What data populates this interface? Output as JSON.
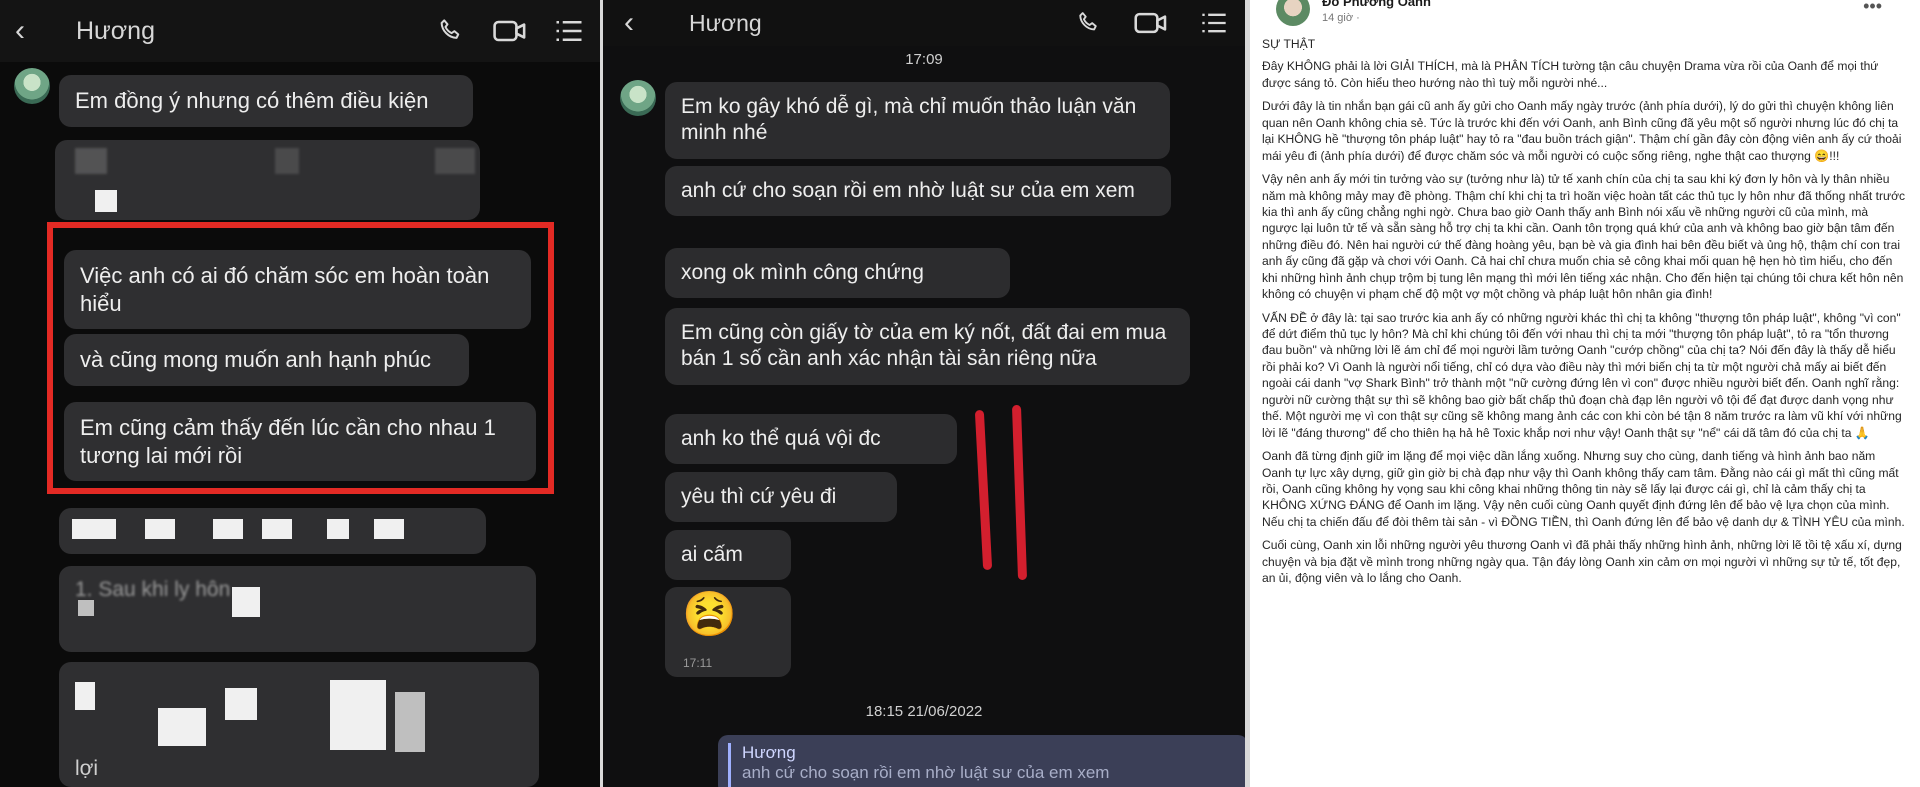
{
  "left_chat": {
    "header": {
      "back_icon": "‹",
      "contact_name": "Hương"
    },
    "messages": [
      "Em đồng ý nhưng có thêm điều kiện",
      "Việc anh có ai đó chăm sóc em hoàn toàn hiểu",
      "và cũng mong muốn anh hạnh phúc",
      "Em cũng cảm thấy đến lúc cần cho nhau 1 tương lai mới rồi"
    ],
    "obscured_fragments": [
      "1. Sau khi ly hôn",
      "lợi"
    ]
  },
  "middle_chat": {
    "header": {
      "back_icon": "‹",
      "contact_name": "Hương"
    },
    "time_top": "17:09",
    "messages": [
      "Em ko gây khó dễ gì, mà chỉ muốn thảo luận văn minh nhé",
      "anh cứ cho soạn rồi em nhờ luật sư của em xem",
      "xong ok mình công chứng",
      "Em cũng còn giấy tờ của em ký nốt, đất đai em mua bán 1 số cần anh xác nhận tài sản riêng nữa",
      "anh ko thể quá vội đc",
      "yêu thì cứ yêu đi",
      "ai cấm"
    ],
    "emoji_time": "17:11",
    "date_separator": "18:15 21/06/2022",
    "reply": {
      "name": "Hương",
      "text": "anh cứ cho soạn rồi em nhờ luật sư của em xem"
    },
    "annotation_color": "#d31f2e"
  },
  "post": {
    "author": "Đỗ Phương Oanh",
    "time": "14 giờ ·",
    "title": "SỰ THẬT",
    "paragraphs": [
      "Đây KHÔNG phải là lời GIẢI THÍCH, mà là PHÂN TÍCH tường tận câu chuyện Drama vừa rồi của Oanh để mọi thứ được sáng tỏ. Còn hiểu theo hướng nào thì tuỳ mỗi người nhé...",
      "Dưới đây là tin nhắn bạn gái cũ anh ấy gửi cho Oanh mấy ngày trước (ảnh phía dưới), lý do gửi thì chuyện không liên quan nên Oanh không chia sẻ. Tức là trước khi đến với Oanh, anh Bình cũng đã yêu một số người nhưng lúc đó chị ta lại KHÔNG hề \"thượng tôn pháp luật\" hay tỏ ra \"đau buồn trách giận\". Thậm chí gần đây còn động viên anh ấy cứ thoải mái yêu đi (ảnh phía dưới) để được chăm sóc và mỗi người có cuộc sống riêng, nghe thật cao thượng 😄!!!",
      "Vậy nên anh ấy mới tin tưởng vào sự (tưởng như là) tử tế xanh chín của chị ta sau khi ký đơn ly hôn và ly thân nhiều năm mà không mảy may đề phòng. Thậm chí khi chị ta trì hoãn việc hoàn tất các thủ tục ly hôn như đã thống nhất trước kia thì anh ấy cũng chẳng nghi ngờ. Chưa bao giờ Oanh thấy anh Bình nói xấu về những người cũ của mình, mà ngược lại luôn tử tế và sẵn sàng hỗ trợ chị ta khi cần. Oanh tôn trọng quá khứ của anh và không bao giờ bận tâm đến những điều đó. Nên hai người cứ thế đàng hoàng yêu, bạn bè và gia đình hai bên đều biết và ủng hộ, thậm chí con trai anh ấy cũng đã gặp và chơi với Oanh. Cả hai chỉ chưa muốn chia sẻ công khai mối quan hệ hẹn hò tìm hiểu, cho đến khi những hình ảnh chụp trộm bị tung lên mạng thì mới lên tiếng xác nhận. Cho đến hiện tại chúng tôi chưa kết hôn nên không có chuyện vi phạm chế độ một vợ một chồng và pháp luật hôn nhân gia đình!",
      "VẤN ĐỀ ở đây là: tại sao trước kia anh ấy có những người khác thì chị ta không \"thượng tôn pháp luật\", không \"vì con\" để dứt điểm thủ tục ly hôn? Mà chỉ khi chúng tôi đến với nhau thì chị ta mới \"thượng tôn pháp luật\", tỏ ra \"tổn thương đau buồn\" và những lời lẽ ám chỉ để mọi người lầm tưởng Oanh \"cướp chồng\" của chị ta? Nói đến đây là thấy dễ hiểu rồi phải ko? Vì Oanh là người nổi tiếng, chỉ có dựa vào điều này thì mới biến chị ta từ một người chả mấy ai biết đến ngoài cái danh \"vợ Shark Bình\" trở thành một \"nữ cường đứng lên vì con\" được nhiều người biết đến. Oanh nghĩ rằng: người nữ cường thật sự thì sẽ không bao giờ bất chấp thủ đoạn chà đạp lên người vô tội để đạt được danh vọng như thế. Một người mẹ vì con thật sự cũng sẽ không mang ảnh các con khi còn bé tận 8 năm trước ra làm vũ khí với những lời lẽ \"đáng thương\" để cho thiên hạ hả hê Toxic khắp nơi như vậy! Oanh thật sự \"nể\" cái dã tâm đó của chị ta 🙏",
      "Oanh đã từng định giữ im lặng để mọi việc dần lắng xuống. Nhưng suy cho cùng, danh tiếng và hình ảnh bao năm Oanh tự lực xây dựng, giữ gìn giờ bị chà đạp như vậy thì Oanh không thấy cam tâm. Đằng nào cái gì mất thì cũng mất rồi, Oanh cũng không hy vọng sau khi công khai những thông tin này sẽ lấy lại được cái gì, chỉ là cảm thấy chị ta KHÔNG XỨNG ĐÁNG để Oanh im lặng. Vậy nên cuối cùng Oanh quyết định đứng lên để bảo vệ lựa chọn của mình. Nếu chị ta chiến đấu để đòi thêm tài sản - vì ĐỒNG TIỀN, thì Oanh đứng lên để bảo vệ danh dự & TÌNH YÊU của mình.",
      "Cuối cùng, Oanh xin lỗi những người yêu thương Oanh vì đã phải thấy những hình ảnh, những lời lẽ tồi tệ xấu xí, dựng chuyện và bịa đặt về mình trong những ngày qua. Tận đáy lòng Oanh xin cảm ơn mọi người vì những sự tử tế, tốt đẹp, an ủi, động viên và lo lắng cho Oanh."
    ],
    "more_icon": "•••"
  }
}
